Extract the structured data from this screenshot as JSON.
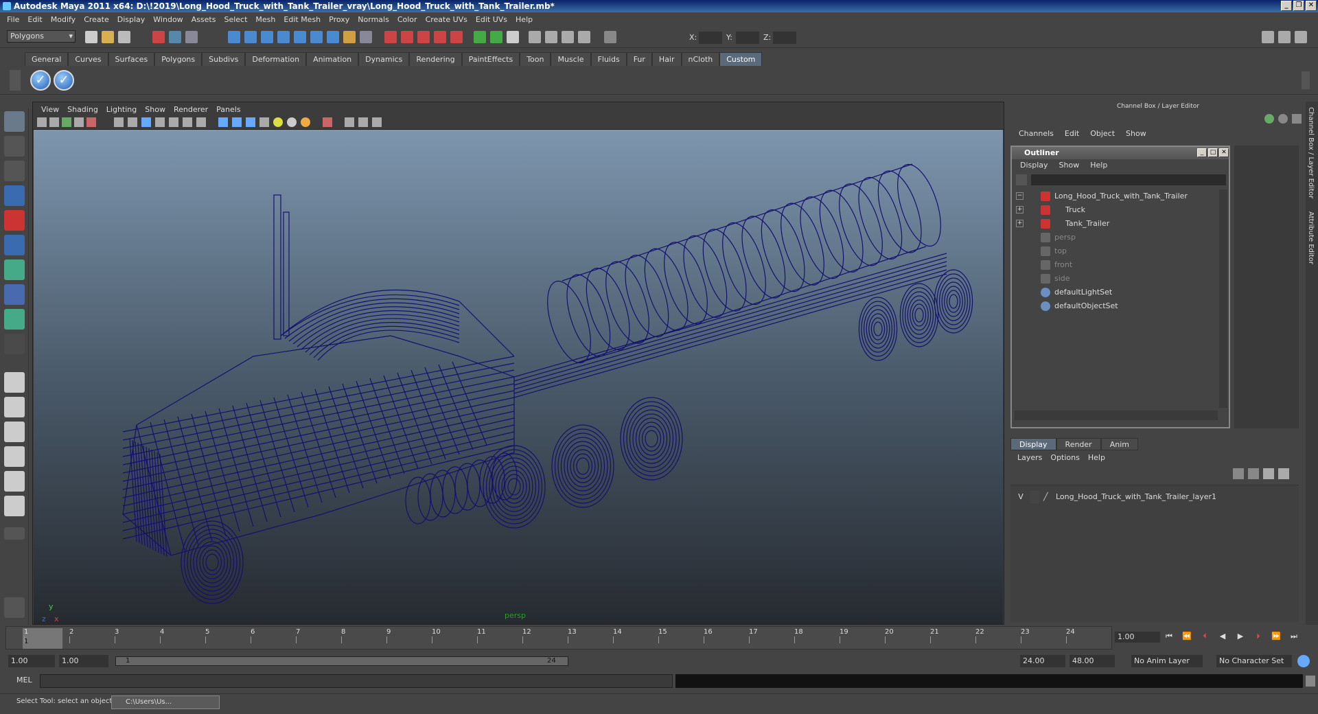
{
  "title": "Autodesk Maya 2011 x64: D:\\!2019\\Long_Hood_Truck_with_Tank_Trailer_vray\\Long_Hood_Truck_with_Tank_Trailer.mb*",
  "menu": [
    "File",
    "Edit",
    "Modify",
    "Create",
    "Display",
    "Window",
    "Assets",
    "Select",
    "Mesh",
    "Edit Mesh",
    "Proxy",
    "Normals",
    "Color",
    "Create UVs",
    "Edit UVs",
    "Help"
  ],
  "mode_selector": "Polygons",
  "coord_labels": {
    "x": "X:",
    "y": "Y:",
    "z": "Z:"
  },
  "shelf_tabs": [
    "General",
    "Curves",
    "Surfaces",
    "Polygons",
    "Subdivs",
    "Deformation",
    "Animation",
    "Dynamics",
    "Rendering",
    "PaintEffects",
    "Toon",
    "Muscle",
    "Fluids",
    "Fur",
    "Hair",
    "nCloth",
    "Custom"
  ],
  "active_shelf": "Custom",
  "viewport": {
    "menu": [
      "View",
      "Shading",
      "Lighting",
      "Show",
      "Renderer",
      "Panels"
    ],
    "camera_label": "persp",
    "axis_x": "x",
    "axis_y": "y",
    "axis_z": "z",
    "wire_color": "#14106e"
  },
  "channel_box": {
    "header": "Channel Box / Layer Editor",
    "menu": [
      "Channels",
      "Edit",
      "Object",
      "Show"
    ]
  },
  "outliner": {
    "title": "Outliner",
    "menu": [
      "Display",
      "Show",
      "Help"
    ],
    "items": [
      {
        "label": "Long_Hood_Truck_with_Tank_Trailer",
        "indent": 0,
        "expander": "−",
        "dim": false
      },
      {
        "label": "Truck",
        "indent": 1,
        "expander": "+",
        "dim": false
      },
      {
        "label": "Tank_Trailer",
        "indent": 1,
        "expander": "+",
        "dim": false
      },
      {
        "label": "persp",
        "indent": 0,
        "expander": "",
        "dim": true
      },
      {
        "label": "top",
        "indent": 0,
        "expander": "",
        "dim": true
      },
      {
        "label": "front",
        "indent": 0,
        "expander": "",
        "dim": true
      },
      {
        "label": "side",
        "indent": 0,
        "expander": "",
        "dim": true
      },
      {
        "label": "defaultLightSet",
        "indent": 0,
        "expander": "",
        "dim": false
      },
      {
        "label": "defaultObjectSet",
        "indent": 0,
        "expander": "",
        "dim": false
      }
    ]
  },
  "layer_editor": {
    "tabs": [
      "Display",
      "Render",
      "Anim"
    ],
    "active_tab": "Display",
    "menu": [
      "Layers",
      "Options",
      "Help"
    ],
    "layer_visibility": "V",
    "layer_name": "Long_Hood_Truck_with_Tank_Trailer_layer1"
  },
  "side_tabs": [
    "Channel Box / Layer Editor",
    "Attribute Editor"
  ],
  "time_slider": {
    "ticks": [
      "1",
      "2",
      "3",
      "4",
      "5",
      "6",
      "7",
      "8",
      "9",
      "10",
      "11",
      "12",
      "13",
      "14",
      "15",
      "16",
      "17",
      "18",
      "19",
      "20",
      "21",
      "22",
      "23",
      "24"
    ],
    "current_marker": "1",
    "current_frame": "1.00"
  },
  "range": {
    "start": "1.00",
    "start_inner": "1.00",
    "slider_start": "1",
    "slider_end": "24",
    "end_inner": "24.00",
    "end": "48.00",
    "anim_layer": "No Anim Layer",
    "character_set": "No Character Set"
  },
  "mel": {
    "label": "MEL"
  },
  "help_line": "Select Tool: select an object",
  "taskbar_item": "C:\\Users\\Us..."
}
